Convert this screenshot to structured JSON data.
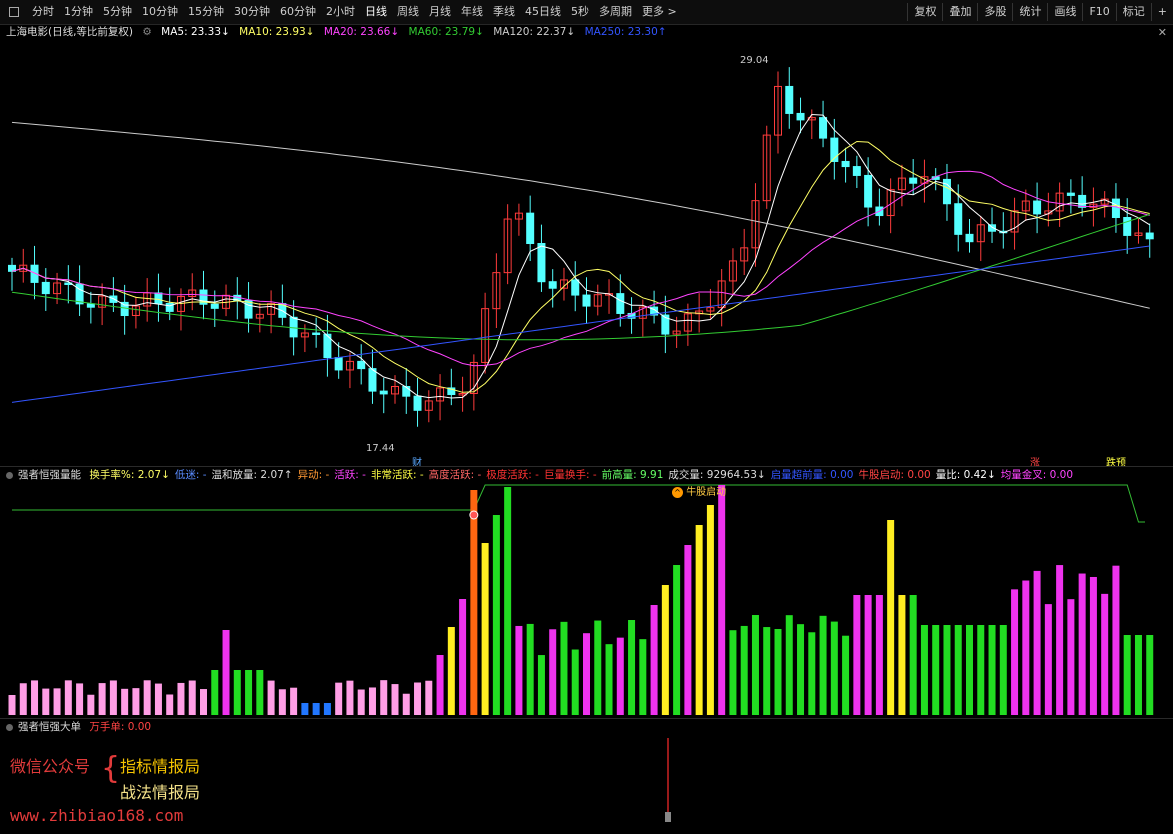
{
  "toolbar": {
    "periods": [
      "分时",
      "1分钟",
      "5分钟",
      "10分钟",
      "15分钟",
      "30分钟",
      "60分钟",
      "2小时",
      "日线",
      "周线",
      "月线",
      "年线",
      "季线",
      "45日线",
      "5秒",
      "多周期",
      "更多 >"
    ],
    "active_period": "日线",
    "actions": [
      "复权",
      "叠加",
      "多股",
      "统计",
      "画线",
      "F10",
      "标记",
      "+"
    ]
  },
  "legend": {
    "title": "上海电影(日线,等比前复权)",
    "ma5": "MA5: 23.33↓",
    "ma10": "MA10: 23.93↓",
    "ma20": "MA20: 23.66↓",
    "ma60": "MA60: 23.79↓",
    "ma120": "MA120: 22.37↓",
    "ma250": "MA250: 23.30↑"
  },
  "price_annotations": {
    "high": "29.04",
    "low": "17.44",
    "tag_cai": "财",
    "tag_zhang": "涨",
    "tag_dieyu": "跌预"
  },
  "volume_panel": {
    "name": "强者恒强量能",
    "items": [
      {
        "text": "换手率%: 2.07↓",
        "color": "#ffff66"
      },
      {
        "text": "低迷: -",
        "color": "#5a8cff"
      },
      {
        "text": "温和放量: 2.07↑",
        "color": "#dddddd"
      },
      {
        "text": "异动: -",
        "color": "#ff9933"
      },
      {
        "text": "活跃: -",
        "color": "#ff44ff"
      },
      {
        "text": "非常活跃: -",
        "color": "#ffff44"
      },
      {
        "text": "高度活跃: -",
        "color": "#ff6666"
      },
      {
        "text": "极度活跃: -",
        "color": "#ff3333"
      },
      {
        "text": "巨量换手: -",
        "color": "#ff3333"
      },
      {
        "text": "前高量: 9.91",
        "color": "#66ff66"
      },
      {
        "text": "成交量: 92964.53↓",
        "color": "#dddddd"
      },
      {
        "text": "启量超前量: 0.00",
        "color": "#3355ff"
      },
      {
        "text": "牛股启动: 0.00",
        "color": "#ff4444"
      },
      {
        "text": "量比: 0.42↓",
        "color": "#ffffff"
      },
      {
        "text": "均量金叉: 0.00",
        "color": "#ff44ff"
      }
    ],
    "signal_label": "牛股启动"
  },
  "big_order_panel": {
    "name": "强者恒强大单",
    "value": "万手单: 0.00"
  },
  "watermark": {
    "wechat": "微信公众号",
    "line1": "指标情报局",
    "line2": "战法情报局",
    "site": "www.zhibiao168.com"
  },
  "colors": {
    "up": "#ff3c3c",
    "down": "#54ffff",
    "ma5": "#ffffff",
    "ma10": "#ffff66",
    "ma20": "#ff44ff",
    "ma60": "#33cc33",
    "ma120": "#cccccc",
    "ma250": "#3355ff",
    "vol_pink": "#ff9ee6",
    "vol_green": "#22dd22",
    "vol_magenta": "#ee33ee",
    "vol_yellow": "#ffee22",
    "vol_blue": "#2277ff",
    "vol_orange": "#ff6611"
  }
}
